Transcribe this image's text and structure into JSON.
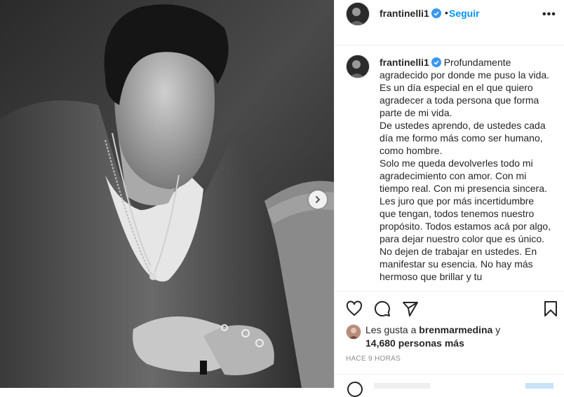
{
  "post": {
    "username": "frantinelli1",
    "dot": "•",
    "follow_label": "Seguir",
    "more_label": "•••",
    "caption": [
      "Profundamente agradecido por donde me puso la vida.",
      "Es un día especial en el que quiero agradecer a toda persona que forma parte de mi vida.",
      "De ustedes aprendo, de ustedes cada día me formo más como ser humano, como hombre.",
      "Solo me queda devolverles todo mi agradecimiento con amor. Con mi tiempo real. Con mi presencia sincera. Les juro que por más incertidumbre que tengan, todos tenemos nuestro propósito. Todos estamos acá por algo, para dejar nuestro color que es único. No dejen de trabajar en ustedes. En manifestar su esencia. No hay más hermoso que brillar y tu"
    ],
    "likes": {
      "prefix": "Les gusta a",
      "liker": "brenmarmedina",
      "suffix": "y",
      "count": "14,680 personas más"
    },
    "time_ago": "HACE 9 HORAS"
  },
  "icons": {
    "like": "heart-icon",
    "comment": "comment-icon",
    "share": "paper-plane-icon",
    "save": "bookmark-icon",
    "next": "chevron-right-icon",
    "verified": "verified-badge-icon"
  },
  "colors": {
    "accent": "#0095f6",
    "verified": "#3897f0",
    "text": "#262626",
    "muted": "#8e8e8e"
  }
}
